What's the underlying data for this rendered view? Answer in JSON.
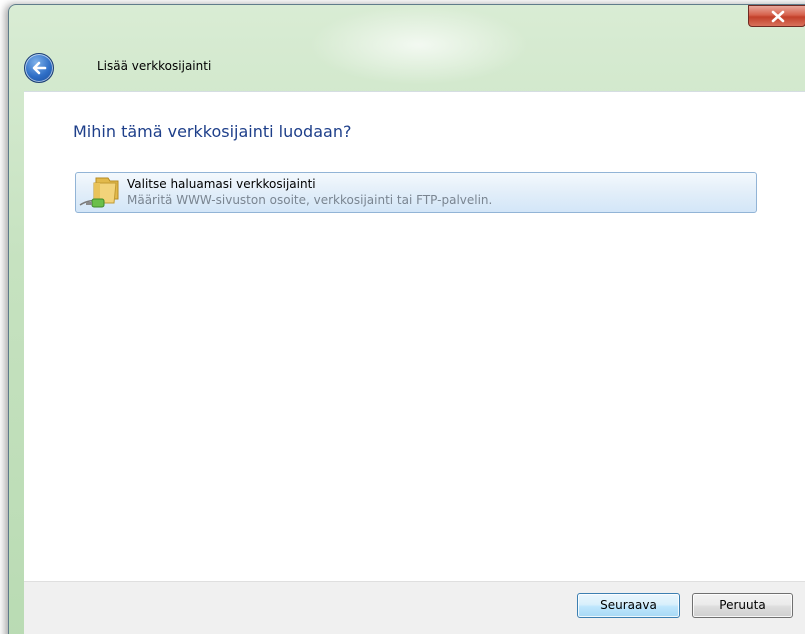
{
  "window": {
    "title": "Lisää verkkosijainti",
    "close_label": "x"
  },
  "main": {
    "heading": "Mihin tämä verkkosijainti luodaan?",
    "option": {
      "title": "Valitse haluamasi verkkosijainti",
      "description": "Määritä WWW-sivuston osoite, verkkosijainti tai FTP-palvelin.",
      "icon": "network-folder-icon"
    }
  },
  "footer": {
    "next_label": "Seuraava",
    "cancel_label": "Peruuta"
  },
  "colors": {
    "heading": "#1e3f8a",
    "description": "#7a8591",
    "frame": "#c6e2c0",
    "close_button": "#c2402a",
    "back_button": "#2e6ec6"
  },
  "icons": {
    "back": "back-arrow-icon",
    "close": "close-icon"
  }
}
